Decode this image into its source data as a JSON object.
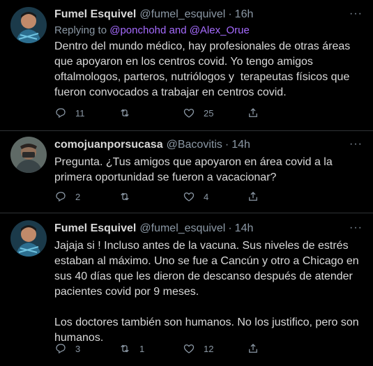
{
  "tweets": [
    {
      "name": "Fumel Esquivel",
      "handle": "@fumel_esquivel",
      "sep": "·",
      "time": "16h",
      "more": "···",
      "replying_prefix": "Replying to",
      "replying_users": "@ponchohd and @Alex_Orue",
      "text": "Dentro del mundo médico, hay profesionales de otras áreas que apoyaron en los centros covid. Yo tengo amigos oftalmologos, parteros, nutriólogos y  terapeutas físicos que fueron convocados a trabajar en centros covid.",
      "replies": "11",
      "retweets": "",
      "likes": "25"
    },
    {
      "name": "comojuanporsucasa",
      "handle": "@Bacovitis",
      "sep": "·",
      "time": "14h",
      "more": "···",
      "text": "Pregunta. ¿Tus amigos que apoyaron en área covid a la primera oportunidad se fueron a vacacionar?",
      "replies": "2",
      "retweets": "",
      "likes": "4"
    },
    {
      "name": "Fumel Esquivel",
      "handle": "@fumel_esquivel",
      "sep": "·",
      "time": "14h",
      "more": "···",
      "text": "Jajaja si ! Incluso antes de la vacuna. Sus niveles de estrés estaban al máximo. Uno se fue a Cancún y otro a Chicago en sus 40 días que les dieron de descanso después de atender pacientes covid por 9 meses.\n\nLos doctores también son humanos. No los justifico, pero son humanos.",
      "replies": "3",
      "retweets": "1",
      "likes": "12"
    }
  ],
  "icons": [
    "reply-icon",
    "retweet-icon",
    "like-icon",
    "share-icon"
  ],
  "colors": {
    "background": "#000000",
    "text": "#d9d9d9",
    "muted": "#8b98a5",
    "link": "#a66bff",
    "divider": "#2f3336"
  }
}
